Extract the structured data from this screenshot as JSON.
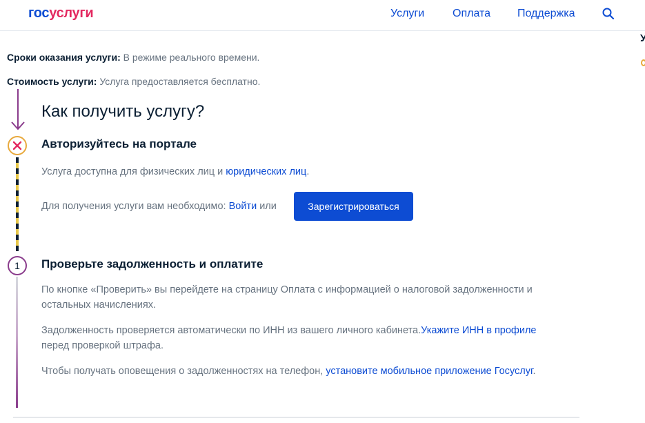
{
  "header": {
    "logo_part1": "гос",
    "logo_part2": "услуги",
    "nav": [
      "Услуги",
      "Оплата",
      "Поддержка"
    ],
    "search_icon": "search-icon"
  },
  "right_edge": {
    "cut_letter": "У"
  },
  "info": {
    "terms_label": "Сроки оказания услуги:",
    "terms_value": "В режиме реального времени.",
    "cost_label": "Стоимость услуги:",
    "cost_value": "Услуга предоставляется бесплатно."
  },
  "section": {
    "title": "Как получить услугу?",
    "step_auth": {
      "title": "Авторизуйтесь на портале",
      "availability_text": "Услуга доступна для физических лиц и ",
      "availability_link": "юридических лиц",
      "availability_end": ".",
      "need_text": "Для получения услуги вам необходимо: ",
      "login_link": "Войти",
      "or_text": " или",
      "register_button": "Зарегистрироваться"
    },
    "step_1": {
      "number": "1",
      "title": "Проверьте задолженность и оплатите",
      "p1": "По кнопке «Проверить» вы перейдете на страницу Оплата с информацией о налоговой задолженности и остальных начислениях.",
      "p2_text": "Задолженность проверяется автоматически по ИНН из вашего личного кабинета.",
      "p2_link": "Укажите ИНН в профиле",
      "p2_end": " перед проверкой штрафа.",
      "p3_text": "Чтобы получать оповещения о задолженностях на телефон, ",
      "p3_link": "установите мобильное приложение Госуслуг",
      "p3_end": "."
    }
  },
  "colors": {
    "brand_blue": "#0d4cd3",
    "brand_red": "#e3285f",
    "purple": "#8a3c8c",
    "orange": "#e8a93c",
    "error_red": "#e3285f",
    "text_gray": "#66727f"
  }
}
